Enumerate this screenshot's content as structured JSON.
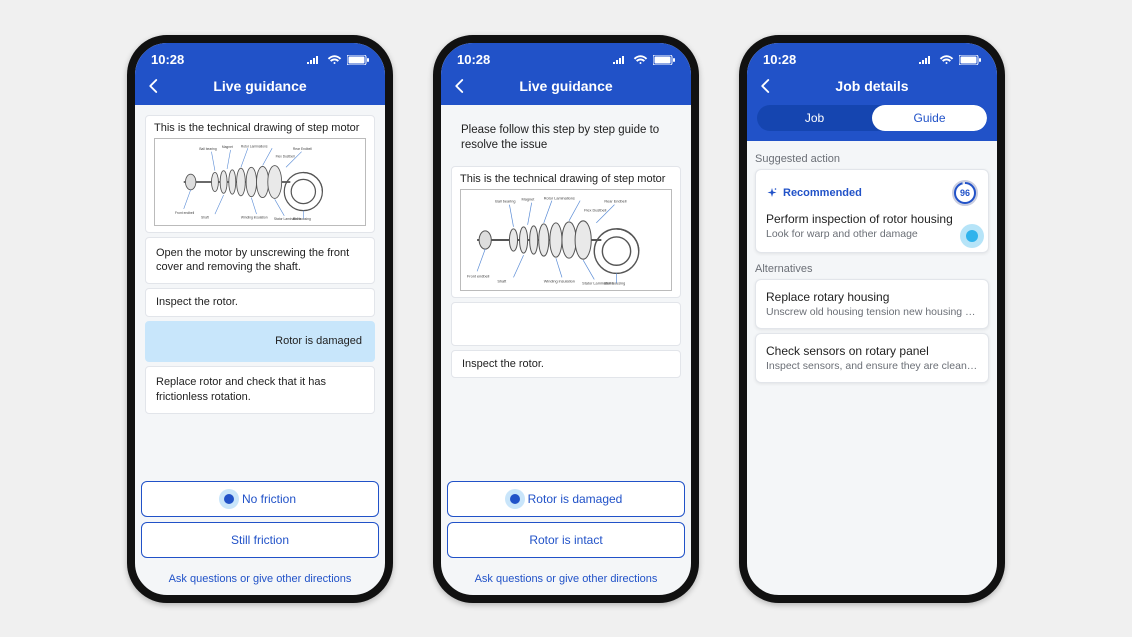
{
  "status_time": "10:28",
  "phone1": {
    "header_title": "Live guidance",
    "cap_drawing": "This is the technical drawing of step motor",
    "step_open": "Open the motor by unscrewing the front cover and removing the shaft.",
    "step_inspect": "Inspect the rotor.",
    "selected": "Rotor is damaged",
    "step_replace": "Replace rotor and check that it has frictionless rotation.",
    "btn1": "No friction",
    "btn2": "Still friction",
    "link": "Ask questions or give other directions"
  },
  "phone2": {
    "header_title": "Live guidance",
    "intro": "Please follow this step by step guide to resolve the issue",
    "cap_drawing": "This is the technical drawing of step motor",
    "step_inspect": "Inspect the rotor.",
    "btn1": "Rotor is damaged",
    "btn2": "Rotor is intact",
    "link": "Ask questions or give other directions"
  },
  "phone3": {
    "header_title": "Job details",
    "tab_job": "Job",
    "tab_guide": "Guide",
    "section_suggested": "Suggested action",
    "rec_label": "Recommended",
    "score": "96",
    "rec_title": "Perform inspection of rotor housing",
    "rec_sub": "Look for warp and other damage",
    "section_alt": "Alternatives",
    "alt1_title": "Replace rotary housing",
    "alt1_sub": "Unscrew old housing tension new housing tor...",
    "alt2_title": "Check sensors on rotary panel",
    "alt2_sub": "Inspect sensors, and ensure they are cleaned o..."
  },
  "diagram_labels": {
    "a": "Rotor Laminations",
    "b": "Ball bearing",
    "c": "Magnet",
    "d": "Shaft",
    "e": "Front endbell",
    "f": "Rear Endbell",
    "g": "Flex Dustbell",
    "h": "Winding insulation",
    "i": "Stator Laminations",
    "j": "Bell housing"
  }
}
